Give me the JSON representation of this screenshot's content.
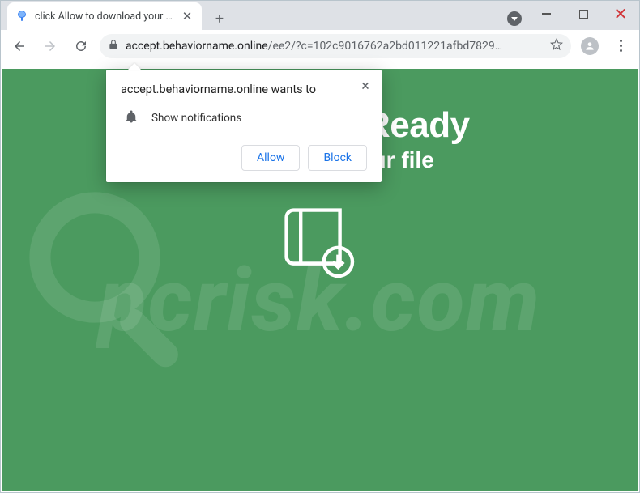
{
  "window": {
    "tab": {
      "title": "click Allow to download your file",
      "favicon_color_top": "#5aa4f7",
      "favicon_color_bottom": "#2b6be0"
    },
    "newtab_glyph": "+",
    "controls": {
      "minimize": "min",
      "maximize": "max",
      "close": "close"
    }
  },
  "toolbar": {
    "back_icon": "arrow-left",
    "forward_icon": "arrow-right",
    "reload_icon": "reload",
    "lock_icon": "lock",
    "url_host": "accept.behaviorname.online",
    "url_rest": "/ee2/?c=102c9016762a2bd011221afbd7829…",
    "star_icon": "star",
    "avatar_icon": "avatar",
    "overflow_icon": "kebab"
  },
  "page": {
    "bg_color": "#4b9a5f",
    "title": "Your File Is Ready",
    "subtitle": "to download your file",
    "book_icon": "book-download",
    "watermark_text": "pcrisk.com"
  },
  "prompt": {
    "origin_line": "accept.behaviorname.online wants to",
    "permission_label": "Show notifications",
    "allow_label": "Allow",
    "block_label": "Block",
    "close_glyph": "×",
    "bell_icon": "bell"
  }
}
